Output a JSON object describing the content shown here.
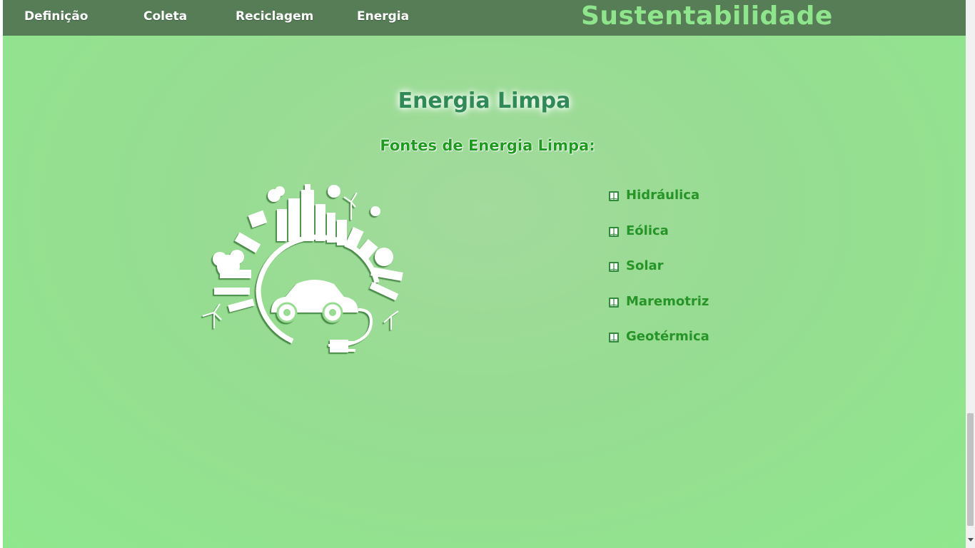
{
  "nav": {
    "items": [
      {
        "label": "Definição"
      },
      {
        "label": "Coleta"
      },
      {
        "label": "Reciclagem"
      },
      {
        "label": "Energia"
      }
    ],
    "brand": "Sustentabilidade"
  },
  "main": {
    "title": "Energia Limpa",
    "subtitle": "Fontes de Energia Limpa:",
    "sources": [
      {
        "label": "Hidráulica"
      },
      {
        "label": "Eólica"
      },
      {
        "label": "Solar"
      },
      {
        "label": "Maremotriz"
      },
      {
        "label": "Geotérmica"
      }
    ],
    "list_icon": "book-icon"
  },
  "colors": {
    "navbar": "#577d57",
    "brand": "#8ee58b",
    "background": "#92e28f",
    "title": "#2f8a57",
    "accent": "#279427"
  }
}
